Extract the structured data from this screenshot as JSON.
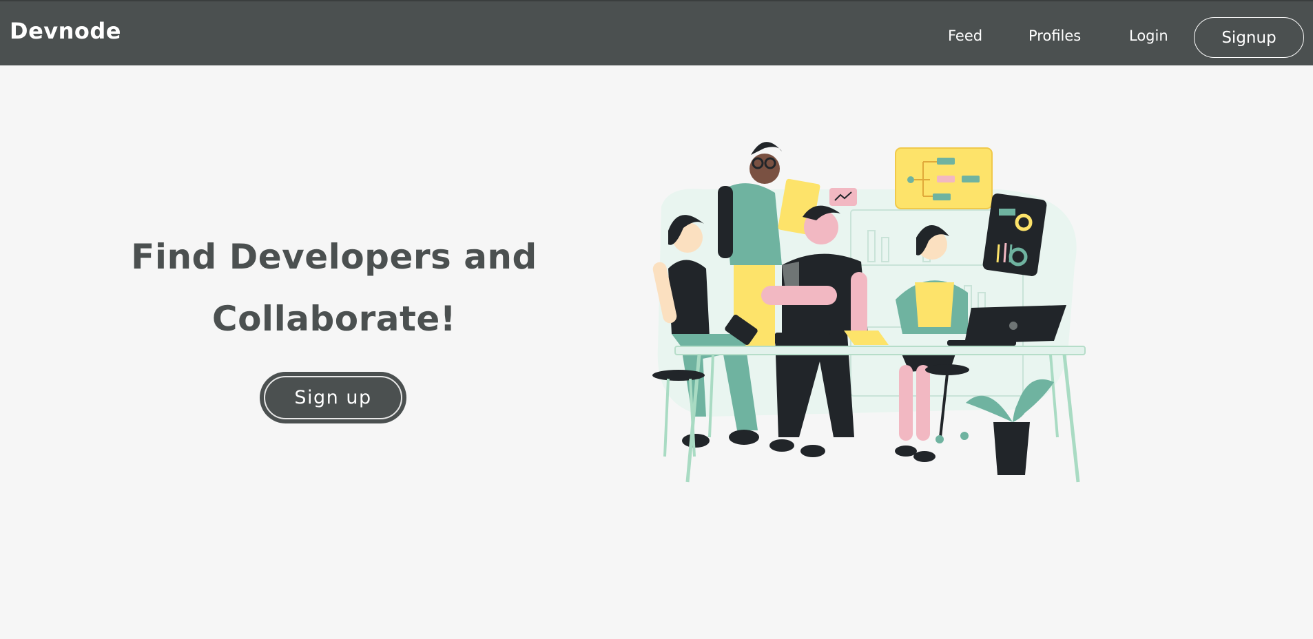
{
  "navbar": {
    "brand": "Devnode",
    "links": [
      "Feed",
      "Profiles",
      "Login"
    ],
    "signup_label": "Signup"
  },
  "hero": {
    "title_line1": "Find Developers and",
    "title_line2": "Collaborate!",
    "cta_label": "Sign up"
  },
  "colors": {
    "navbar_bg": "#4b5050",
    "page_bg": "#f6f6f6",
    "accent_green": "#6fb3a0",
    "accent_yellow": "#fde36a",
    "accent_pink": "#f2b8c2",
    "dark": "#212529"
  },
  "illustration": {
    "icon": "team-collaboration-illustration"
  }
}
